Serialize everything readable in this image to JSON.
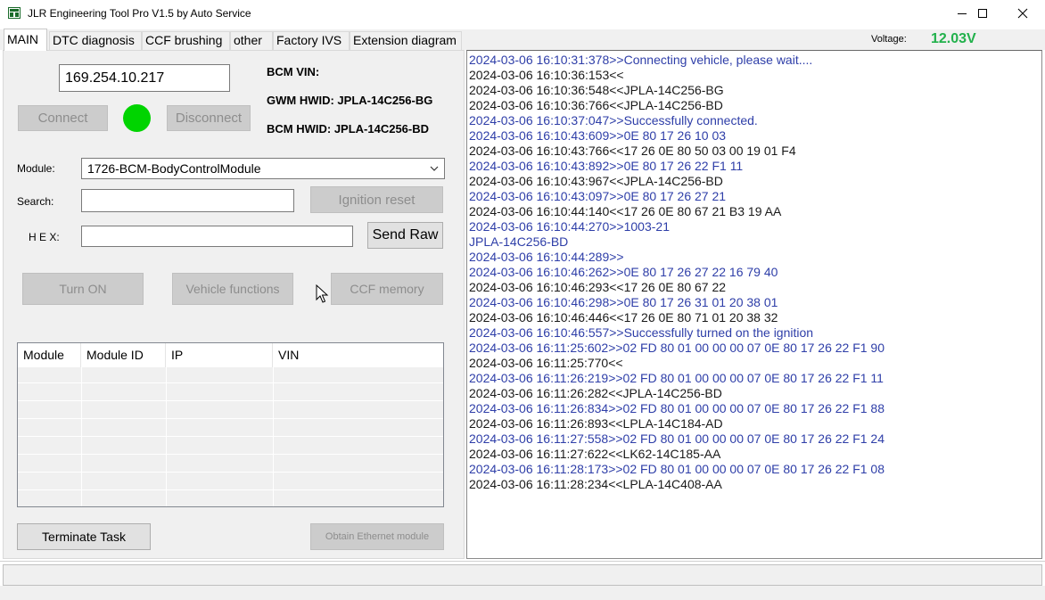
{
  "window": {
    "title": "JLR Engineering Tool Pro V1.5 by Auto Service",
    "app_icon": "app-logo-icon",
    "controls": [
      "minimize-icon",
      "maximize-icon",
      "close-icon"
    ]
  },
  "tabs": [
    {
      "label": "MAIN",
      "active": true
    },
    {
      "label": "DTC diagnosis"
    },
    {
      "label": "CCF brushing"
    },
    {
      "label": "other"
    },
    {
      "label": "Factory IVS"
    },
    {
      "label": "Extension diagram"
    }
  ],
  "voltage": {
    "label": "Voltage:",
    "value": "12.03V",
    "color": "#22b14c"
  },
  "connection": {
    "ip": "169.254.10.217",
    "connect_label": "Connect",
    "disconnect_label": "Disconnect",
    "status_color": "#00d400"
  },
  "vehicle_info": {
    "bcm_vin": "BCM VIN:",
    "gwm_hwid": "GWM HWID: JPLA-14C256-BG",
    "bcm_hwid": "BCM HWID: JPLA-14C256-BD"
  },
  "form": {
    "module_label": "Module:",
    "module_value": "1726-BCM-BodyControlModule",
    "search_label": "Search:",
    "search_value": "",
    "hex_label": "H E X:",
    "hex_value": ""
  },
  "buttons": {
    "ignition_reset": "Ignition reset",
    "send_raw": "Send Raw",
    "turn_on": "Turn ON",
    "vehicle_functions": "Vehicle functions",
    "ccf_memory": "CCF memory",
    "terminate_task": "Terminate Task",
    "obtain_ethernet": "Obtain Ethernet module"
  },
  "device_table": {
    "columns": [
      "Module",
      "Module ID",
      "IP",
      "VIN"
    ],
    "rows": []
  },
  "log": [
    {
      "text": "2024-03-06 16:10:31:378>>Connecting vehicle, please wait....",
      "dir": "sent"
    },
    {
      "text": "2024-03-06 16:10:36:153<<",
      "dir": "recv"
    },
    {
      "text": "2024-03-06 16:10:36:548<<JPLA-14C256-BG",
      "dir": "recv"
    },
    {
      "text": "2024-03-06 16:10:36:766<<JPLA-14C256-BD",
      "dir": "recv"
    },
    {
      "text": "2024-03-06 16:10:37:047>>Successfully connected.",
      "dir": "sent"
    },
    {
      "text": "2024-03-06 16:10:43:609>>0E 80 17 26 10 03",
      "dir": "sent"
    },
    {
      "text": "2024-03-06 16:10:43:766<<17 26 0E 80 50 03 00 19 01 F4",
      "dir": "recv"
    },
    {
      "text": "2024-03-06 16:10:43:892>>0E 80 17 26 22 F1 11",
      "dir": "sent"
    },
    {
      "text": "2024-03-06 16:10:43:967<<JPLA-14C256-BD",
      "dir": "recv"
    },
    {
      "text": "2024-03-06 16:10:43:097>>0E 80 17 26 27 21",
      "dir": "sent"
    },
    {
      "text": "2024-03-06 16:10:44:140<<17 26 0E 80 67 21 B3 19 AA",
      "dir": "recv"
    },
    {
      "text": "2024-03-06 16:10:44:270>>1003-21",
      "dir": "sent"
    },
    {
      "text": "JPLA-14C256-BD",
      "dir": "sent"
    },
    {
      "text": "2024-03-06 16:10:44:289>>",
      "dir": "sent"
    },
    {
      "text": "2024-03-06 16:10:46:262>>0E 80 17 26 27 22 16 79 40",
      "dir": "sent"
    },
    {
      "text": "2024-03-06 16:10:46:293<<17 26 0E 80 67 22",
      "dir": "recv"
    },
    {
      "text": "2024-03-06 16:10:46:298>>0E 80 17 26 31 01 20 38 01",
      "dir": "sent"
    },
    {
      "text": "2024-03-06 16:10:46:446<<17 26 0E 80 71 01 20 38 32",
      "dir": "recv"
    },
    {
      "text": "2024-03-06 16:10:46:557>>Successfully turned on the ignition",
      "dir": "sent"
    },
    {
      "text": "2024-03-06 16:11:25:602>>02 FD 80 01 00 00 00 07 0E 80 17 26 22 F1 90",
      "dir": "sent"
    },
    {
      "text": "2024-03-06 16:11:25:770<<",
      "dir": "recv"
    },
    {
      "text": "2024-03-06 16:11:26:219>>02 FD 80 01 00 00 00 07 0E 80 17 26 22 F1 11",
      "dir": "sent"
    },
    {
      "text": "2024-03-06 16:11:26:282<<JPLA-14C256-BD",
      "dir": "recv"
    },
    {
      "text": "2024-03-06 16:11:26:834>>02 FD 80 01 00 00 00 07 0E 80 17 26 22 F1 88",
      "dir": "sent"
    },
    {
      "text": "2024-03-06 16:11:26:893<<LPLA-14C184-AD",
      "dir": "recv"
    },
    {
      "text": "2024-03-06 16:11:27:558>>02 FD 80 01 00 00 00 07 0E 80 17 26 22 F1 24",
      "dir": "sent"
    },
    {
      "text": "2024-03-06 16:11:27:622<<LK62-14C185-AA",
      "dir": "recv"
    },
    {
      "text": "2024-03-06 16:11:28:173>>02 FD 80 01 00 00 00 07 0E 80 17 26 22 F1 08",
      "dir": "sent"
    },
    {
      "text": "2024-03-06 16:11:28:234<<LPLA-14C408-AA",
      "dir": "recv"
    }
  ],
  "statusbar": {
    "text": ""
  }
}
